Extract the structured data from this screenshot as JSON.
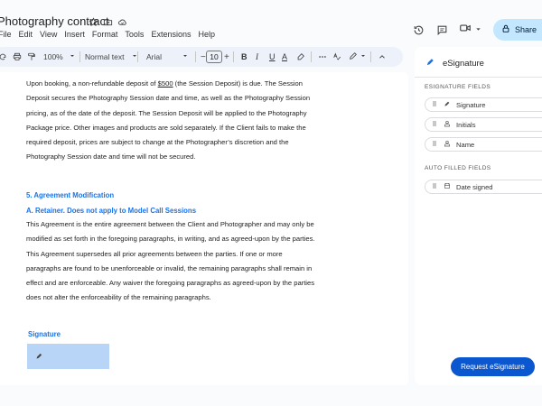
{
  "titlebar": {
    "doc_title": "Photography contract",
    "icons": [
      "star-icon",
      "folder-move-icon",
      "cloud-status-icon"
    ]
  },
  "menu": [
    "File",
    "Edit",
    "View",
    "Insert",
    "Format",
    "Tools",
    "Extensions",
    "Help"
  ],
  "header_right": {
    "icons": [
      "history-icon",
      "comment-icon",
      "video-camera-icon",
      "chevron-down-icon"
    ],
    "share_label": "Share"
  },
  "toolbar": {
    "zoom": "100%",
    "style": "Normal text",
    "font": "Arial",
    "font_size": "10",
    "minus": "−",
    "plus": "+",
    "bold": "B",
    "italic": "I",
    "underline": "U",
    "text_color": "A"
  },
  "document": {
    "para1": [
      "Upon booking, a non-refundable deposit of ",
      "$500",
      " (the Session Deposit) is due. The Session Deposit secures the Photography Session date and time, as well as the Photography Session pricing, as of the date of the deposit. The Session Deposit will be applied to the Photography Package price. Other images and products are sold separately. If the Client fails to make the required deposit, prices are subject to change at the Photographer’s discretion and the Photography Session date and time will not be secured."
    ],
    "heading1": "5. Agreement Modification",
    "heading2": "A. Retainer.  Does not apply to Model Call Sessions",
    "para2": "This Agreement is the entire agreement between the Client and Photographer and may only be modified as set forth in the foregoing paragraphs, in writing, and as agreed-upon by the parties. This Agreement supersedes all prior agreements between the parties. If one or more paragraphs are found to be unenforceable or invalid, the remaining paragraphs shall remain in effect and are enforceable. Any waiver the foregoing paragraphs as agreed-upon by the parties does not alter the enforceability of the remaining paragraphs.",
    "signature_label": "Signature"
  },
  "panel": {
    "title": "eSignature",
    "esig_section": "ESIGNATURE FIELDS",
    "esig_fields": [
      "Signature",
      "Initials",
      "Name"
    ],
    "auto_section": "AUTO FILLED FIELDS",
    "auto_fields": [
      "Date signed"
    ],
    "request_button": "Request eSignature"
  },
  "colors": {
    "accent": "#1a73e8",
    "share_bg": "#c2e7ff",
    "request_bg": "#0b57d0",
    "signature_box": "#b8d4f7",
    "toolbar_bg": "#edf2fa"
  }
}
